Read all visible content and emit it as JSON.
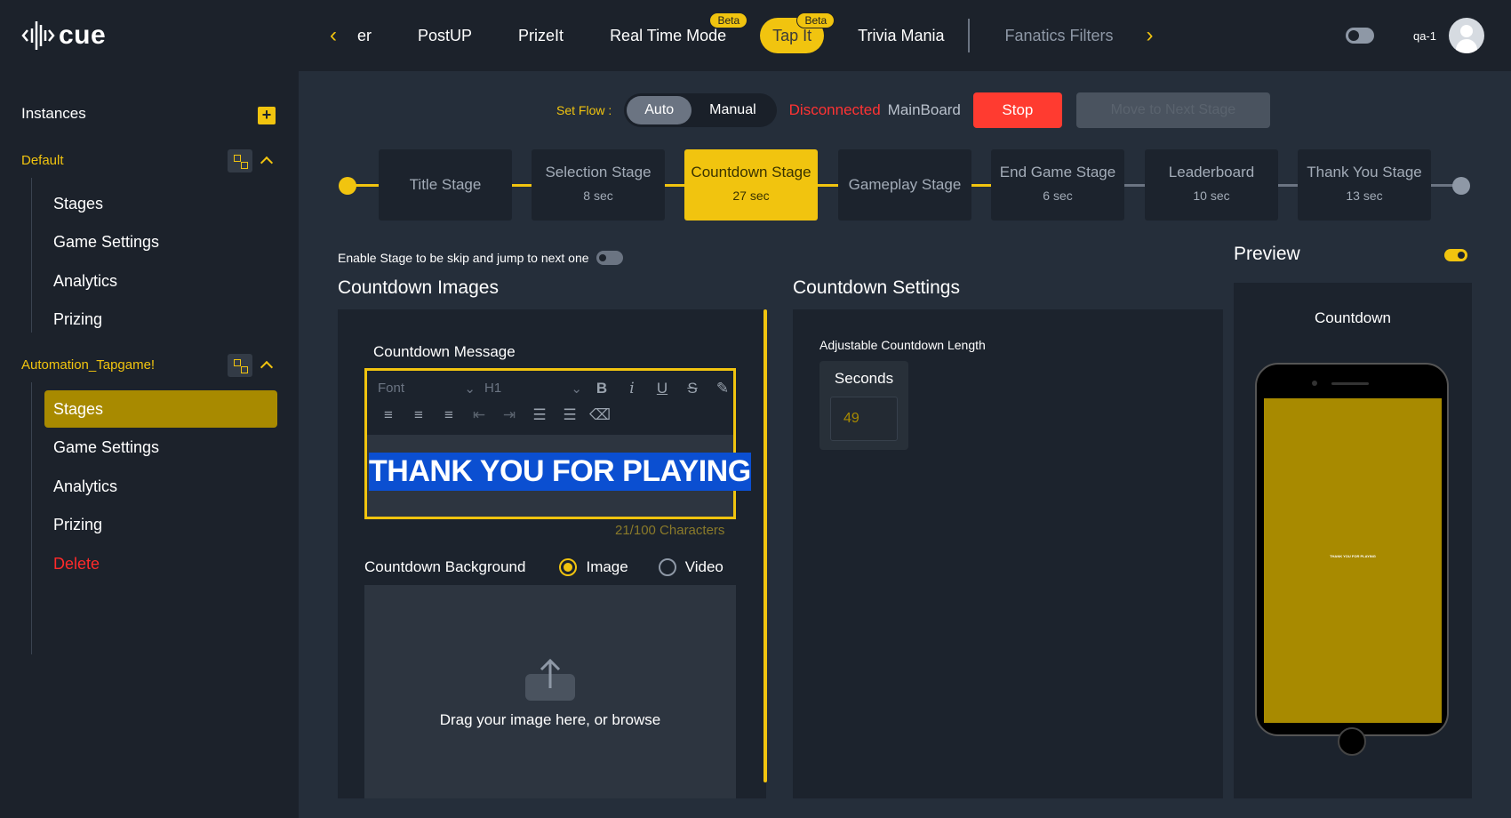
{
  "app": {
    "logo_text": "cue"
  },
  "nav": {
    "tabs": [
      {
        "label": "er"
      },
      {
        "label": "PostUP"
      },
      {
        "label": "PrizeIt"
      },
      {
        "label": "Real Time Mode",
        "badge": "Beta"
      },
      {
        "label": "Tap It",
        "badge": "Beta",
        "active": true
      },
      {
        "label": "Trivia Mania"
      },
      {
        "label": "Fanatics Filters"
      }
    ]
  },
  "user": {
    "name": "qa-1"
  },
  "sidebar": {
    "header": "Instances",
    "groups": [
      {
        "title": "Default",
        "items": [
          "Stages",
          "Game Settings",
          "Analytics",
          "Prizing"
        ]
      },
      {
        "title": "Automation_Tapgame!",
        "items": [
          "Stages",
          "Game Settings",
          "Analytics",
          "Prizing",
          "Delete"
        ],
        "active_item": "Stages"
      }
    ]
  },
  "flow": {
    "label": "Set Flow :",
    "options": [
      "Auto",
      "Manual"
    ],
    "selected": "Auto",
    "status_disconnected": "Disconnected",
    "status_board": "MainBoard",
    "stop_label": "Stop",
    "next_label": "Move to Next Stage"
  },
  "stages": [
    {
      "name": "Title Stage",
      "time": ""
    },
    {
      "name": "Selection Stage",
      "time": "8 sec"
    },
    {
      "name": "Countdown Stage",
      "time": "27 sec",
      "active": true
    },
    {
      "name": "Gameplay Stage",
      "time": ""
    },
    {
      "name": "End Game Stage",
      "time": "6 sec"
    },
    {
      "name": "Leaderboard",
      "time": "10 sec"
    },
    {
      "name": "Thank You Stage",
      "time": "13 sec"
    }
  ],
  "skip": {
    "label": "Enable Stage to be skip and jump to next one"
  },
  "images": {
    "title": "Countdown Images",
    "message_label": "Countdown Message",
    "toolbar": {
      "font_placeholder": "Font",
      "heading_value": "H1"
    },
    "message_text": "THANK YOU FOR PLAYING",
    "char_count": "21/100 Characters",
    "background_label": "Countdown Background",
    "bg_options": [
      "Image",
      "Video"
    ],
    "bg_selected": "Image",
    "upload_text": "Drag your image here, or browse"
  },
  "settings": {
    "title": "Countdown Settings",
    "adjustable_label": "Adjustable Countdown Length",
    "seconds_label": "Seconds",
    "seconds_value": "49"
  },
  "preview": {
    "title": "Preview",
    "screen_label": "Countdown",
    "phone_text": "THANK YOU FOR PLAYING"
  },
  "colors": {
    "accent": "#f1c40f",
    "danger": "#ff3b30",
    "panel": "#1c232d",
    "background": "#252e3a"
  }
}
